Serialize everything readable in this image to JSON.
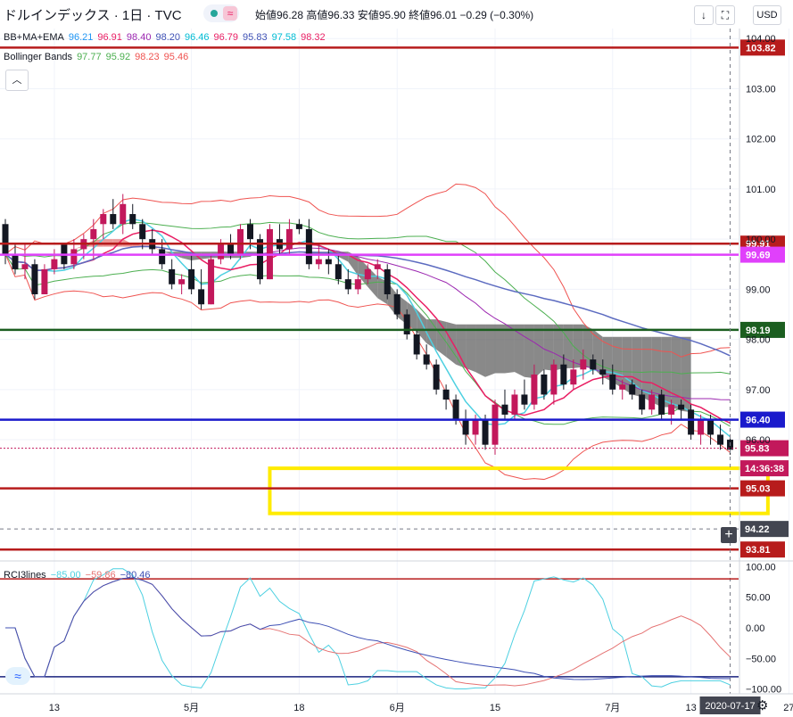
{
  "header": {
    "symbol": "ドルインデックス · 1日 · TVC",
    "ohlc_text": "始値96.28 高値96.33 安値95.90 終値96.01 −0.29 (−0.30%)",
    "currency_button": "USD",
    "btn_down": "↓",
    "btn_fullscreen": "⛶"
  },
  "legends": {
    "bb_ma_ema": {
      "name": "BB+MA+EMA",
      "values": [
        {
          "v": "96.21",
          "color": "#2196f3"
        },
        {
          "v": "96.91",
          "color": "#e91e63"
        },
        {
          "v": "98.40",
          "color": "#9c27b0"
        },
        {
          "v": "98.20",
          "color": "#3f51b5"
        },
        {
          "v": "96.46",
          "color": "#00bcd4"
        },
        {
          "v": "96.79",
          "color": "#e91e63"
        },
        {
          "v": "95.83",
          "color": "#3f51b5"
        },
        {
          "v": "97.58",
          "color": "#00bcd4"
        },
        {
          "v": "98.32",
          "color": "#e91e63"
        }
      ]
    },
    "bollinger": {
      "name": "Bollinger Bands",
      "values": [
        {
          "v": "97.77",
          "color": "#4caf50"
        },
        {
          "v": "95.92",
          "color": "#4caf50"
        },
        {
          "v": "98.23",
          "color": "#ef5350"
        },
        {
          "v": "95.46",
          "color": "#ef5350"
        }
      ]
    },
    "rci": {
      "name": "RCI3lines",
      "values": [
        {
          "v": "−85.00",
          "color": "#4dd0e1"
        },
        {
          "v": "−59.86",
          "color": "#e57373"
        },
        {
          "v": "−80.46",
          "color": "#3f51b5"
        }
      ]
    }
  },
  "colors": {
    "up": "#c2185b",
    "down": "#131722",
    "kumo_bull": "#e57373",
    "kumo_bear": "#616161",
    "line_red": "#b71c1c",
    "line_green": "#1b5e20",
    "line_blue": "#1a1acc",
    "line_magenta": "#e040fb",
    "highlight_box": "#ffeb00",
    "axis_text": "#131722"
  },
  "chart_data": [
    {
      "type": "candlestick",
      "y_axis": {
        "ylim": [
          93.6,
          104.2
        ],
        "ticks": [
          "104.00",
          "103.00",
          "102.00",
          "101.00",
          "100.00",
          "99.00",
          "98.00",
          "97.00",
          "96.00"
        ]
      },
      "x_axis": {
        "ticks": [
          {
            "label": "13",
            "date": "2020-04-13"
          },
          {
            "label": "5月",
            "date": "2020-05-01"
          },
          {
            "label": "18",
            "date": "2020-05-18"
          },
          {
            "label": "6月",
            "date": "2020-06-01"
          },
          {
            "label": "15",
            "date": "2020-06-15"
          },
          {
            "label": "7月",
            "date": "2020-07-01"
          },
          {
            "label": "13",
            "date": "2020-07-13"
          },
          {
            "label": "27",
            "date": "2020-07-27"
          }
        ],
        "cursor_label": "2020-07-17"
      },
      "ohlc": [
        {
          "d": "2020-04-06",
          "o": 100.3,
          "h": 100.4,
          "l": 99.5,
          "c": 99.7
        },
        {
          "d": "2020-04-07",
          "o": 99.7,
          "h": 99.9,
          "l": 99.3,
          "c": 99.4
        },
        {
          "d": "2020-04-08",
          "o": 99.4,
          "h": 99.9,
          "l": 99.2,
          "c": 99.5
        },
        {
          "d": "2020-04-09",
          "o": 99.5,
          "h": 99.6,
          "l": 98.8,
          "c": 98.9
        },
        {
          "d": "2020-04-10",
          "o": 98.9,
          "h": 99.5,
          "l": 98.9,
          "c": 99.4
        },
        {
          "d": "2020-04-13",
          "o": 99.4,
          "h": 99.8,
          "l": 99.3,
          "c": 99.6
        },
        {
          "d": "2020-04-14",
          "o": 99.9,
          "h": 99.9,
          "l": 99.4,
          "c": 99.5
        },
        {
          "d": "2020-04-15",
          "o": 99.5,
          "h": 100.0,
          "l": 99.4,
          "c": 99.8
        },
        {
          "d": "2020-04-16",
          "o": 99.8,
          "h": 100.1,
          "l": 99.6,
          "c": 100.0
        },
        {
          "d": "2020-04-17",
          "o": 100.0,
          "h": 100.4,
          "l": 99.6,
          "c": 100.2
        },
        {
          "d": "2020-04-20",
          "o": 100.3,
          "h": 100.6,
          "l": 100.0,
          "c": 100.5
        },
        {
          "d": "2020-04-21",
          "o": 100.5,
          "h": 100.8,
          "l": 100.2,
          "c": 100.3
        },
        {
          "d": "2020-04-22",
          "o": 100.3,
          "h": 100.9,
          "l": 100.1,
          "c": 100.7
        },
        {
          "d": "2020-04-23",
          "o": 100.5,
          "h": 100.7,
          "l": 100.2,
          "c": 100.3
        },
        {
          "d": "2020-04-24",
          "o": 100.3,
          "h": 100.4,
          "l": 99.8,
          "c": 100.0
        },
        {
          "d": "2020-04-27",
          "o": 100.0,
          "h": 100.2,
          "l": 99.7,
          "c": 99.8
        },
        {
          "d": "2020-04-28",
          "o": 99.8,
          "h": 100.0,
          "l": 99.4,
          "c": 99.5
        },
        {
          "d": "2020-04-29",
          "o": 99.4,
          "h": 99.6,
          "l": 99.0,
          "c": 99.1
        },
        {
          "d": "2020-04-30",
          "o": 99.1,
          "h": 99.3,
          "l": 98.9,
          "c": 99.2
        },
        {
          "d": "2020-05-01",
          "o": 99.4,
          "h": 99.7,
          "l": 98.9,
          "c": 99.0
        },
        {
          "d": "2020-05-04",
          "o": 99.0,
          "h": 99.4,
          "l": 98.6,
          "c": 98.7
        },
        {
          "d": "2020-05-05",
          "o": 98.7,
          "h": 99.7,
          "l": 98.7,
          "c": 99.6
        },
        {
          "d": "2020-05-06",
          "o": 99.6,
          "h": 100.0,
          "l": 99.5,
          "c": 99.9
        },
        {
          "d": "2020-05-07",
          "o": 99.9,
          "h": 100.1,
          "l": 99.6,
          "c": 99.7
        },
        {
          "d": "2020-05-08",
          "o": 99.7,
          "h": 100.3,
          "l": 99.6,
          "c": 100.2
        },
        {
          "d": "2020-05-11",
          "o": 100.3,
          "h": 100.4,
          "l": 99.8,
          "c": 100.0
        },
        {
          "d": "2020-05-12",
          "o": 100.0,
          "h": 100.1,
          "l": 99.1,
          "c": 99.2
        },
        {
          "d": "2020-05-13",
          "o": 99.2,
          "h": 100.3,
          "l": 99.2,
          "c": 100.2
        },
        {
          "d": "2020-05-14",
          "o": 100.0,
          "h": 100.3,
          "l": 99.7,
          "c": 99.8
        },
        {
          "d": "2020-05-15",
          "o": 99.8,
          "h": 100.4,
          "l": 99.7,
          "c": 100.2
        },
        {
          "d": "2020-05-18",
          "o": 100.3,
          "h": 100.4,
          "l": 100.1,
          "c": 100.2
        },
        {
          "d": "2020-05-19",
          "o": 100.2,
          "h": 100.4,
          "l": 99.4,
          "c": 99.5
        },
        {
          "d": "2020-05-20",
          "o": 99.5,
          "h": 99.9,
          "l": 99.4,
          "c": 99.6
        },
        {
          "d": "2020-05-21",
          "o": 99.6,
          "h": 99.8,
          "l": 99.3,
          "c": 99.5
        },
        {
          "d": "2020-05-22",
          "o": 99.5,
          "h": 99.7,
          "l": 99.1,
          "c": 99.2
        },
        {
          "d": "2020-05-25",
          "o": 99.2,
          "h": 99.4,
          "l": 98.9,
          "c": 99.0
        },
        {
          "d": "2020-05-26",
          "o": 99.0,
          "h": 99.3,
          "l": 98.9,
          "c": 99.2
        },
        {
          "d": "2020-05-27",
          "o": 99.2,
          "h": 99.5,
          "l": 99.1,
          "c": 99.4
        },
        {
          "d": "2020-05-28",
          "o": 99.4,
          "h": 99.6,
          "l": 99.2,
          "c": 99.5
        },
        {
          "d": "2020-05-29",
          "o": 99.4,
          "h": 99.5,
          "l": 98.8,
          "c": 98.9
        },
        {
          "d": "2020-06-01",
          "o": 98.9,
          "h": 99.0,
          "l": 98.4,
          "c": 98.5
        },
        {
          "d": "2020-06-02",
          "o": 98.5,
          "h": 98.6,
          "l": 98.0,
          "c": 98.1
        },
        {
          "d": "2020-06-03",
          "o": 98.1,
          "h": 98.2,
          "l": 97.6,
          "c": 97.7
        },
        {
          "d": "2020-06-04",
          "o": 97.7,
          "h": 97.9,
          "l": 97.4,
          "c": 97.5
        },
        {
          "d": "2020-06-05",
          "o": 97.5,
          "h": 97.6,
          "l": 96.9,
          "c": 97.0
        },
        {
          "d": "2020-06-08",
          "o": 97.0,
          "h": 97.1,
          "l": 96.6,
          "c": 96.8
        },
        {
          "d": "2020-06-09",
          "o": 96.8,
          "h": 96.9,
          "l": 96.3,
          "c": 96.4
        },
        {
          "d": "2020-06-10",
          "o": 96.4,
          "h": 96.6,
          "l": 95.9,
          "c": 96.1
        },
        {
          "d": "2020-06-11",
          "o": 96.1,
          "h": 96.5,
          "l": 95.9,
          "c": 96.4
        },
        {
          "d": "2020-06-12",
          "o": 96.4,
          "h": 96.5,
          "l": 95.8,
          "c": 95.9
        },
        {
          "d": "2020-06-15",
          "o": 95.9,
          "h": 96.8,
          "l": 95.7,
          "c": 96.7
        },
        {
          "d": "2020-06-16",
          "o": 96.7,
          "h": 97.0,
          "l": 96.4,
          "c": 96.5
        },
        {
          "d": "2020-06-17",
          "o": 96.5,
          "h": 97.0,
          "l": 96.4,
          "c": 96.9
        },
        {
          "d": "2020-06-18",
          "o": 96.9,
          "h": 97.2,
          "l": 96.6,
          "c": 96.7
        },
        {
          "d": "2020-06-19",
          "o": 96.7,
          "h": 97.5,
          "l": 96.6,
          "c": 97.3
        },
        {
          "d": "2020-06-22",
          "o": 97.3,
          "h": 97.4,
          "l": 96.8,
          "c": 96.9
        },
        {
          "d": "2020-06-23",
          "o": 96.9,
          "h": 97.6,
          "l": 96.7,
          "c": 97.5
        },
        {
          "d": "2020-06-24",
          "o": 97.5,
          "h": 97.7,
          "l": 97.0,
          "c": 97.1
        },
        {
          "d": "2020-06-25",
          "o": 97.1,
          "h": 97.6,
          "l": 97.0,
          "c": 97.4
        },
        {
          "d": "2020-06-26",
          "o": 97.4,
          "h": 97.8,
          "l": 97.2,
          "c": 97.6
        },
        {
          "d": "2020-06-29",
          "o": 97.6,
          "h": 97.7,
          "l": 97.3,
          "c": 97.4
        },
        {
          "d": "2020-06-30",
          "o": 97.4,
          "h": 97.6,
          "l": 97.1,
          "c": 97.3
        },
        {
          "d": "2020-07-01",
          "o": 97.3,
          "h": 97.5,
          "l": 96.9,
          "c": 97.0
        },
        {
          "d": "2020-07-02",
          "o": 97.0,
          "h": 97.2,
          "l": 96.8,
          "c": 97.1
        },
        {
          "d": "2020-07-03",
          "o": 97.1,
          "h": 97.2,
          "l": 96.8,
          "c": 96.9
        },
        {
          "d": "2020-07-06",
          "o": 96.9,
          "h": 97.0,
          "l": 96.5,
          "c": 96.6
        },
        {
          "d": "2020-07-07",
          "o": 96.6,
          "h": 97.0,
          "l": 96.5,
          "c": 96.9
        },
        {
          "d": "2020-07-08",
          "o": 96.9,
          "h": 97.0,
          "l": 96.4,
          "c": 96.5
        },
        {
          "d": "2020-07-09",
          "o": 96.5,
          "h": 96.8,
          "l": 96.3,
          "c": 96.7
        },
        {
          "d": "2020-07-10",
          "o": 96.7,
          "h": 96.8,
          "l": 96.4,
          "c": 96.6
        },
        {
          "d": "2020-07-13",
          "o": 96.6,
          "h": 96.7,
          "l": 96.0,
          "c": 96.1
        },
        {
          "d": "2020-07-14",
          "o": 96.1,
          "h": 96.5,
          "l": 95.9,
          "c": 96.4
        },
        {
          "d": "2020-07-15",
          "o": 96.4,
          "h": 96.5,
          "l": 95.9,
          "c": 96.1
        },
        {
          "d": "2020-07-16",
          "o": 96.1,
          "h": 96.3,
          "l": 95.8,
          "c": 95.9
        },
        {
          "d": "2020-07-17",
          "o": 96.0,
          "h": 96.1,
          "l": 95.7,
          "c": 95.8
        }
      ],
      "horizontal_lines": [
        {
          "value": 103.82,
          "label": "103.82",
          "color": "#b71c1c",
          "label_bg": "#b71c1c"
        },
        {
          "value": 99.91,
          "label": "99.91",
          "color": "#b71c1c",
          "label_bg": "#b71c1c"
        },
        {
          "value": 99.69,
          "label": "99.69",
          "color": "#e040fb",
          "label_bg": "#e040fb"
        },
        {
          "value": 98.19,
          "label": "98.19",
          "color": "#1b5e20",
          "label_bg": "#1b5e20"
        },
        {
          "value": 96.4,
          "label": "96.40",
          "color": "#1a1acc",
          "label_bg": "#1a1acc"
        },
        {
          "value": 95.03,
          "label": "95.03",
          "color": "#b71c1c",
          "label_bg": "#b71c1c"
        },
        {
          "value": 93.81,
          "label": "93.81",
          "color": "#b71c1c",
          "label_bg": "#b71c1c"
        }
      ],
      "price_labels": [
        {
          "value": 95.83,
          "label": "95.83",
          "bg": "#c2185b"
        },
        {
          "value": 95.43,
          "label": "14:36:38",
          "bg": "#c2185b"
        },
        {
          "value": 94.22,
          "label": "94.22",
          "bg": "#434651"
        }
      ],
      "highlight_zone": {
        "y_top": 95.43,
        "y_bottom": 94.53,
        "x_start": "2020-05-13",
        "x_end": "2020-07-24"
      }
    },
    {
      "type": "line",
      "name": "RCI3lines",
      "y_axis": {
        "ylim": [
          -108,
          108
        ],
        "ticks": [
          "100.00",
          "50.00",
          "0.00",
          "−50.00",
          "−100.00"
        ]
      },
      "reference_lines": [
        80,
        -80
      ]
    }
  ]
}
